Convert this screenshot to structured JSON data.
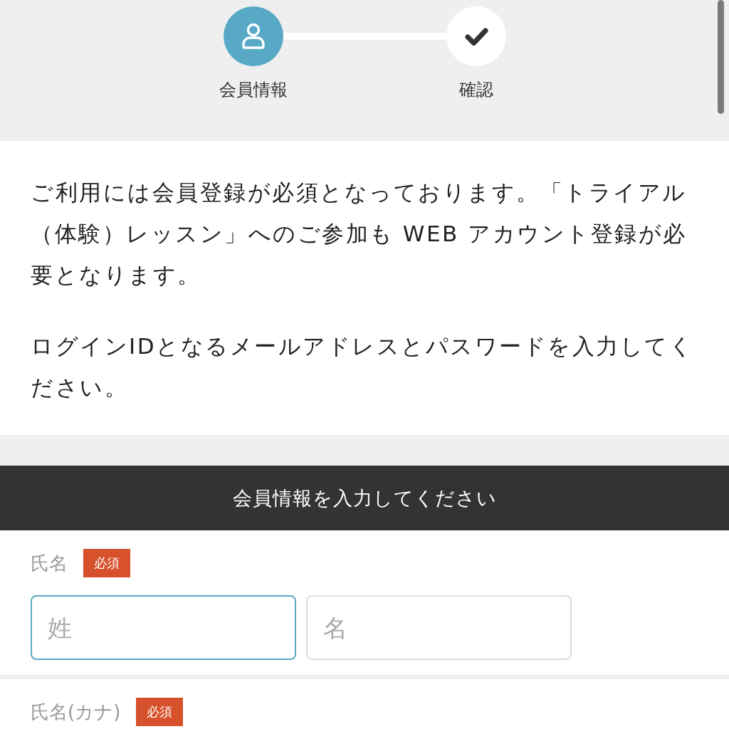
{
  "steps": [
    {
      "label": "会員情報",
      "selected": true
    },
    {
      "label": "確認",
      "selected": false
    }
  ],
  "intro": {
    "paragraphs": [
      "ご利用には会員登録が必須となっております。「トライアル（体験）レッスン」へのご参加も WEB アカウント登録が必要となります。",
      "ログインIDとなるメールアドレスとパスワードを入力してください。"
    ]
  },
  "form": {
    "title": "会員情報を入力してください",
    "fields": [
      {
        "label": "氏名",
        "badge": "必須",
        "inputs": [
          {
            "placeholder": "姓",
            "focused": true
          },
          {
            "placeholder": "名",
            "focused": false
          }
        ]
      },
      {
        "label": "氏名(カナ)",
        "badge": "必須"
      }
    ]
  }
}
